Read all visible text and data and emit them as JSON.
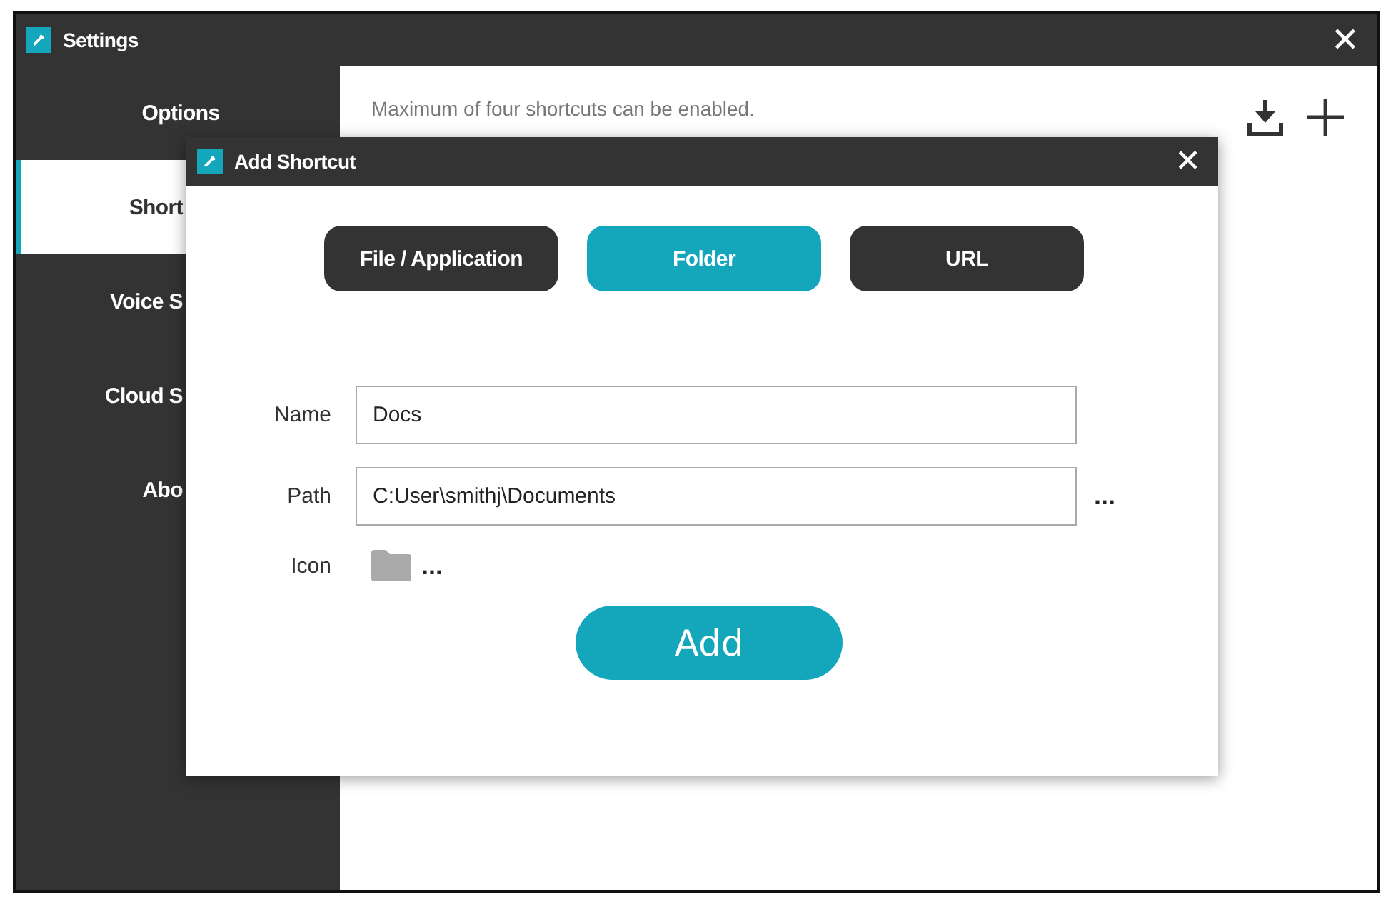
{
  "window": {
    "title": "Settings",
    "close": "✕"
  },
  "sidebar": {
    "items": [
      {
        "label": "Options",
        "selected": false
      },
      {
        "label": "Short",
        "selected": true
      },
      {
        "label": "Voice S",
        "selected": false
      },
      {
        "label": "Cloud S",
        "selected": false
      },
      {
        "label": "Abo",
        "selected": false
      }
    ]
  },
  "content": {
    "notice": "Maximum of four shortcuts can be enabled."
  },
  "dialog": {
    "title": "Add Shortcut",
    "close": "✕",
    "types": [
      {
        "label": "File / Application",
        "selected": false
      },
      {
        "label": "Folder",
        "selected": true
      },
      {
        "label": "URL",
        "selected": false
      }
    ],
    "fields": [
      {
        "label": "Name",
        "value": "Docs"
      },
      {
        "label": "Path",
        "value": "C:User\\smithj\\Documents",
        "browse": "..."
      }
    ],
    "icon": {
      "label": "Icon",
      "browse": "..."
    },
    "submit": "Add"
  }
}
